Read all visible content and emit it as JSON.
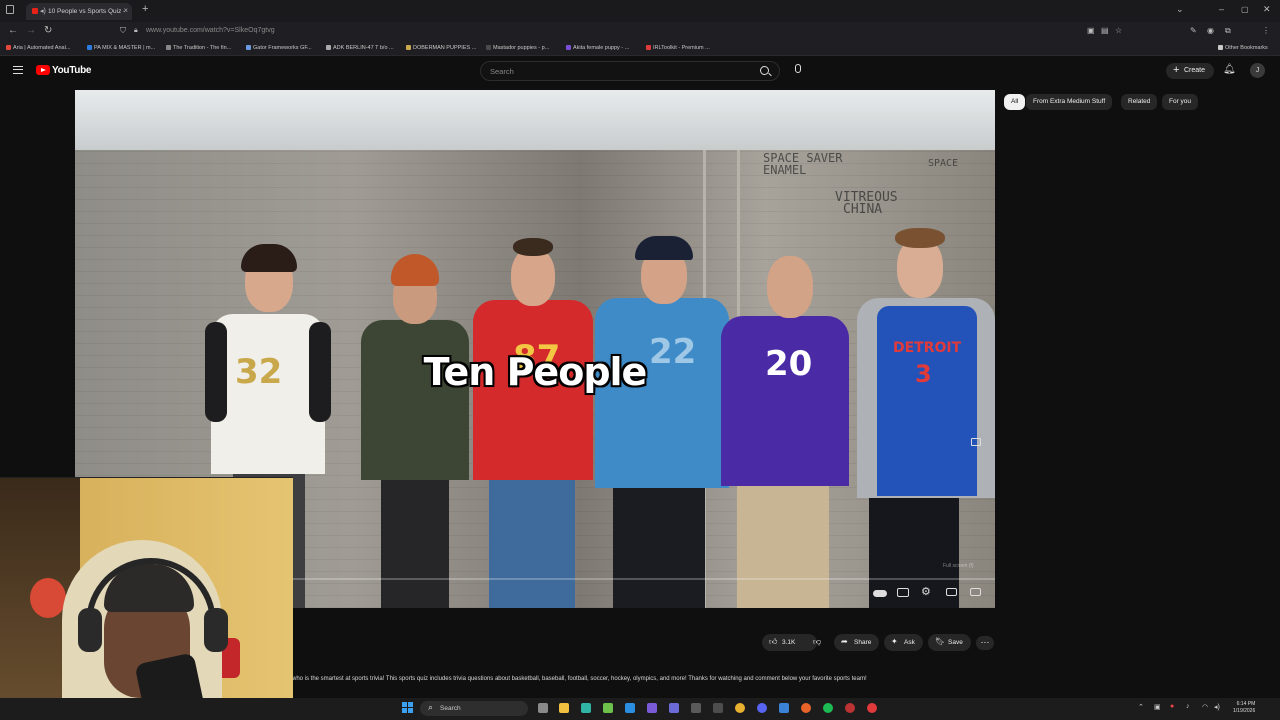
{
  "browser": {
    "tab_title": "10 People vs Sports Quiz -",
    "url": "www.youtube.com/watch?v=SlkeOq7gtvg",
    "bookmarks": [
      {
        "label": "Aria | Automated Anal...",
        "color": "#e4473b"
      },
      {
        "label": "PA MIX & MASTER | m...",
        "color": "#2a7de1"
      },
      {
        "label": "The Tradition - The fin...",
        "color": "#888888"
      },
      {
        "label": "Gator Frameworks GF...",
        "color": "#6a9be0"
      },
      {
        "label": "ADK BERLIN-47 T b/o ...",
        "color": "#aaaaaa"
      },
      {
        "label": "DOBERMAN PUPPIES ...",
        "color": "#c9a94b"
      },
      {
        "label": "Mastador puppies - p...",
        "color": "#4a4a4a"
      },
      {
        "label": "Akita female puppy - ...",
        "color": "#7a4fd6"
      },
      {
        "label": "IRLToolkit - Premium ...",
        "color": "#e23a3a"
      }
    ],
    "other_bookmarks": "Other Bookmarks"
  },
  "youtube": {
    "logo_text": "YouTube",
    "search_placeholder": "Search",
    "create_label": "Create",
    "avatar_letter": "J",
    "chips": [
      "All",
      "From Extra Medium Stuff",
      "Related",
      "For you"
    ]
  },
  "video": {
    "overlay_caption": "Ten People",
    "graffiti_lines": [
      "SPACE SAVER",
      "ENAMEL",
      "VITREOUS",
      "CHINA",
      "SPACE"
    ],
    "fullscreen_hint": "Full screen (f)",
    "jersey_numbers": [
      "32",
      "87",
      "22",
      "20",
      "3"
    ],
    "jersey_text": "DETROIT"
  },
  "actions": {
    "like_count": "3.1K",
    "share_label": "Share",
    "ask_label": "Ask",
    "save_label": "Save"
  },
  "description": "who is the smartest at sports trivia! This sports quiz includes trivia questions about basketball, baseball, football, soccer, hockey, olympics, and more! Thanks for watching and comment below your favorite sports team!",
  "taskbar": {
    "search_label": "Search",
    "time": "6:14 PM",
    "date": "1/19/2026"
  }
}
